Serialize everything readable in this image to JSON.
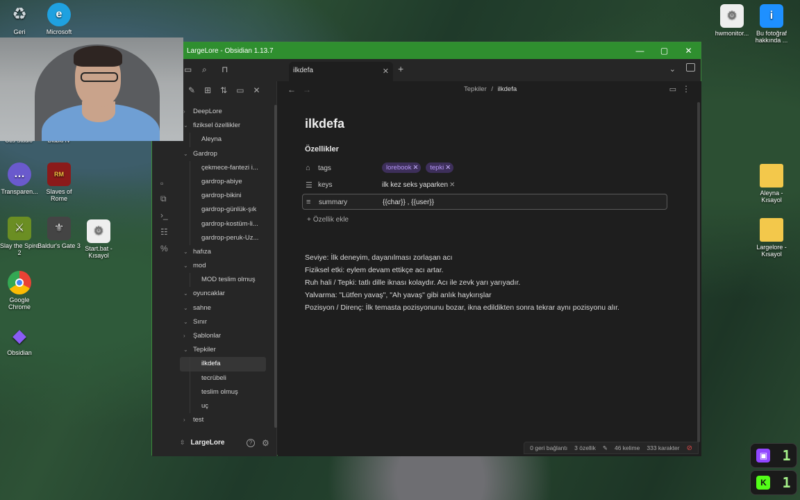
{
  "desktop": {
    "icons_left": [
      {
        "label": "Geri",
        "icon": "recycle-bin-icon",
        "color": "#cfd8dc"
      },
      {
        "label": "Microsoft",
        "icon": "edge-icon",
        "color": "#1fa1e0"
      },
      {
        "label": "Transparen...",
        "icon": "chat-icon",
        "color": "#6a5acd"
      },
      {
        "label": "Slaves of Rome",
        "icon": "game-icon",
        "color": "#8b1a1a"
      },
      {
        "label": "Slay the Spire 2",
        "icon": "game-icon",
        "color": "#6b8e23"
      },
      {
        "label": "Baldur's Gate 3",
        "icon": "game-icon",
        "color": "#444444"
      },
      {
        "label": "Start.bat - Kısayol",
        "icon": "gear-file-icon",
        "color": "#eeeeee"
      },
      {
        "label": "Google Chrome",
        "icon": "chrome-icon",
        "color": "#e94235"
      },
      {
        "label": "Obsidian",
        "icon": "obsidian-icon",
        "color": "#8a5cf5"
      }
    ],
    "partial_labels": [
      "Obs Studio",
      "Diablo IV"
    ],
    "icons_right": [
      {
        "label": "hwmonitor...",
        "icon": "gear-file-icon",
        "color": "#eeeeee"
      },
      {
        "label": "Bu fotoğraf hakkında ...",
        "icon": "info-icon",
        "color": "#1e90ff"
      },
      {
        "label": "Aleyna - Kısayol",
        "icon": "folder-icon",
        "color": "#f3c84b"
      },
      {
        "label": "Largelore - Kısayol",
        "icon": "folder-icon",
        "color": "#f3c84b"
      }
    ],
    "tray": [
      {
        "icon": "twitch-icon",
        "color": "#9146ff",
        "count": "1"
      },
      {
        "icon": "kick-icon",
        "color": "#53fc18",
        "count": "1"
      }
    ]
  },
  "window": {
    "title": "LargeLore - Obsidian 1.13.7",
    "minimize": "—",
    "maximize": "▢",
    "close": "✕",
    "accent": "#2f8f2f"
  },
  "tabs": [
    {
      "label": "ilkdefa"
    }
  ],
  "sidebar": {
    "tree": [
      {
        "label": "DeepLore",
        "type": "folder",
        "open": false
      },
      {
        "label": "fiziksel özellikler",
        "type": "folder",
        "open": true
      },
      {
        "label": "Aleyna",
        "type": "child"
      },
      {
        "label": "Gardrop",
        "type": "folder",
        "open": true
      },
      {
        "label": "çekmece-fantezi i...",
        "type": "child"
      },
      {
        "label": "gardrop-abiye",
        "type": "child"
      },
      {
        "label": "gardrop-bikini",
        "type": "child"
      },
      {
        "label": "gardrop-günlük-şık",
        "type": "child"
      },
      {
        "label": "gardrop-kostüm-li...",
        "type": "child"
      },
      {
        "label": "gardrop-peruk-Uz...",
        "type": "child"
      },
      {
        "label": "hafıza",
        "type": "folder",
        "open": true
      },
      {
        "label": "mod",
        "type": "folder",
        "open": true
      },
      {
        "label": "MOD teslim olmuş",
        "type": "child"
      },
      {
        "label": "oyuncaklar",
        "type": "folder",
        "open": true
      },
      {
        "label": "sahne",
        "type": "folder",
        "open": true
      },
      {
        "label": "Sınır",
        "type": "folder",
        "open": true
      },
      {
        "label": "Şablonlar",
        "type": "folder",
        "open": false
      },
      {
        "label": "Tepkiler",
        "type": "folder",
        "open": true
      },
      {
        "label": "ilkdefa",
        "type": "child",
        "active": true
      },
      {
        "label": "tecrübeli",
        "type": "child"
      },
      {
        "label": "teslim olmuş",
        "type": "child"
      },
      {
        "label": "uç",
        "type": "child"
      },
      {
        "label": "test",
        "type": "folder",
        "open": false
      }
    ],
    "vault_name": "LargeLore"
  },
  "breadcrumb": {
    "folder": "Tepkiler",
    "sep": "/",
    "note": "ilkdefa"
  },
  "note": {
    "title": "ilkdefa",
    "properties_heading": "Özellikler",
    "properties": {
      "tags": {
        "name": "tags",
        "values": [
          "lorebook",
          "tepki"
        ]
      },
      "keys": {
        "name": "keys",
        "values": [
          "ilk kez seks yaparken"
        ]
      },
      "summary": {
        "name": "summary",
        "value": "{{char}} , {{user}}"
      }
    },
    "add_property": "Özellik ekle",
    "body": [
      "Seviye: İlk deneyim, dayanılması zorlaşan acı",
      "Fiziksel etki: eylem devam ettikçe acı artar.",
      "Ruh hali / Tepki:    tatlı dille iknası kolaydır. Acı ile zevk yarı yarıyadır.",
      "Yalvarma: \"Lütfen yavaş\", \"Ah yavaş\" gibi anlık haykırışlar",
      "Pozisyon / Direnç: İlk temasta  pozisyonunu bozar, ikna edildikten sonra  tekrar aynı pozisyonu alır."
    ]
  },
  "status": {
    "backlinks": "0 geri bağlantı",
    "properties": "3 özellik",
    "words": "46 kelime",
    "chars": "333 karakter"
  }
}
